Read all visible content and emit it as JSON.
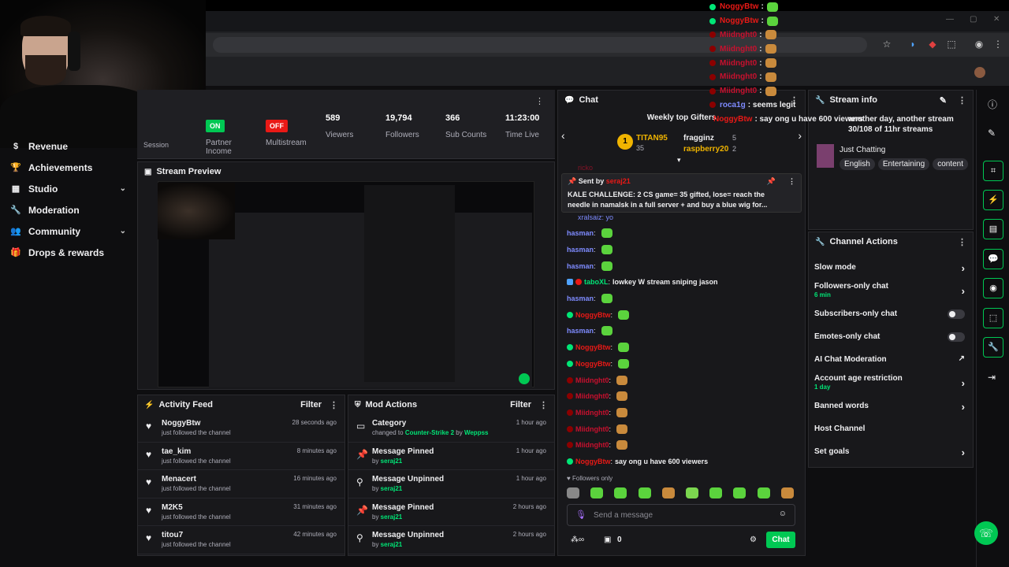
{
  "sidebar": {
    "items": [
      {
        "label": "Revenue",
        "icon": "dollar-icon",
        "expandable": false
      },
      {
        "label": "Achievements",
        "icon": "trophy-icon",
        "expandable": false
      },
      {
        "label": "Studio",
        "icon": "studio-icon",
        "expandable": true
      },
      {
        "label": "Moderation",
        "icon": "wrench-icon",
        "expandable": false
      },
      {
        "label": "Community",
        "icon": "people-icon",
        "expandable": true
      },
      {
        "label": "Drops & rewards",
        "icon": "gift-icon",
        "expandable": false
      }
    ]
  },
  "stats": {
    "partner_income": {
      "badge": "ON",
      "label": "Partner Income"
    },
    "multistream": {
      "badge": "OFF",
      "label": "Multistream"
    },
    "viewers": {
      "value": "589",
      "label": "Viewers"
    },
    "followers": {
      "value": "19,794",
      "label": "Followers"
    },
    "subs": {
      "value": "366",
      "label": "Sub Counts"
    },
    "time": {
      "value": "11:23:00",
      "label": "Time Live"
    },
    "session_label": "Session"
  },
  "preview": {
    "title": "Stream Preview"
  },
  "activity": {
    "title": "Activity Feed",
    "filter": "Filter",
    "items": [
      {
        "name": "NoggyBtw",
        "sub": "just followed the channel",
        "time": "28 seconds ago"
      },
      {
        "name": "tae_kim",
        "sub": "just followed the channel",
        "time": "8 minutes ago"
      },
      {
        "name": "Menacert",
        "sub": "just followed the channel",
        "time": "16 minutes ago"
      },
      {
        "name": "M2K5",
        "sub": "just followed the channel",
        "time": "31 minutes ago"
      },
      {
        "name": "titou7",
        "sub": "just followed the channel",
        "time": "42 minutes ago"
      }
    ]
  },
  "mod_actions": {
    "title": "Mod Actions",
    "filter": "Filter",
    "items": [
      {
        "name": "Category",
        "pre": "changed to ",
        "target": "Counter-Strike 2",
        "mid": " by ",
        "by": "Weppss",
        "time": "1 hour ago",
        "icon": "category-icon"
      },
      {
        "name": "Message Pinned",
        "pre": "by ",
        "target": "seraj21",
        "mid": "",
        "by": "",
        "time": "1 hour ago",
        "icon": "pin-icon"
      },
      {
        "name": "Message Unpinned",
        "pre": "by ",
        "target": "seraj21",
        "mid": "",
        "by": "",
        "time": "1 hour ago",
        "icon": "unpin-icon"
      },
      {
        "name": "Message Pinned",
        "pre": "by ",
        "target": "seraj21",
        "mid": "",
        "by": "",
        "time": "2 hours ago",
        "icon": "pin-icon"
      },
      {
        "name": "Message Unpinned",
        "pre": "by ",
        "target": "seraj21",
        "mid": "",
        "by": "",
        "time": "2 hours ago",
        "icon": "unpin-icon"
      }
    ]
  },
  "chat": {
    "title": "Chat",
    "top_gifters_title": "Weekly top Gifters",
    "gifters": [
      {
        "rank": "1",
        "name": "TITAN95",
        "count": "35"
      },
      {
        "rank": "",
        "name": "fragginz",
        "count": "5"
      },
      {
        "rank": "",
        "name": "raspberry20",
        "count": "2"
      }
    ],
    "pinned": {
      "sent_by_label": "Sent by",
      "sender": "seraj21",
      "text": "KALE CHALLENGE: 2 CS game= 35 gifted, lose= reach the needle in namalsk in a full server + and buy a blue wig for..."
    },
    "partial_top": "ricko",
    "partial_second": "xralsaiz: yo",
    "messages": [
      {
        "nick": "hasman",
        "cls": "nick-h",
        "text": "",
        "emote": true,
        "badge": ""
      },
      {
        "nick": "hasman",
        "cls": "nick-h",
        "text": "",
        "emote": true,
        "badge": ""
      },
      {
        "nick": "hasman",
        "cls": "nick-h",
        "text": "",
        "emote": true,
        "badge": ""
      },
      {
        "nick": "taboXL",
        "cls": "nick-t",
        "text": "lowkey W stream sniping jason",
        "emote": false,
        "badge": "sub"
      },
      {
        "nick": "hasman",
        "cls": "nick-h",
        "text": "",
        "emote": true,
        "badge": ""
      },
      {
        "nick": "NoggyBtw",
        "cls": "nick-n",
        "text": "",
        "emote": true,
        "badge": "green"
      },
      {
        "nick": "hasman",
        "cls": "nick-h",
        "text": "",
        "emote": true,
        "badge": ""
      },
      {
        "nick": "NoggyBtw",
        "cls": "nick-n",
        "text": "",
        "emote": true,
        "badge": "green"
      },
      {
        "nick": "NoggyBtw",
        "cls": "nick-n",
        "text": "",
        "emote": true,
        "badge": "green"
      },
      {
        "nick": "Miidnght0",
        "cls": "nick-m",
        "text": "",
        "emote": true,
        "badge": "red"
      },
      {
        "nick": "Miidnght0",
        "cls": "nick-m",
        "text": "",
        "emote": true,
        "badge": "red"
      },
      {
        "nick": "Miidnght0",
        "cls": "nick-m",
        "text": "",
        "emote": true,
        "badge": "red"
      },
      {
        "nick": "Miidnght0",
        "cls": "nick-m",
        "text": "",
        "emote": true,
        "badge": "red"
      },
      {
        "nick": "Miidnght0",
        "cls": "nick-m",
        "text": "",
        "emote": true,
        "badge": "red"
      },
      {
        "nick": "NoggyBtw",
        "cls": "nick-n",
        "text": "say ong u have 600 viewers",
        "emote": false,
        "badge": "green"
      }
    ],
    "followers_only": "Followers only",
    "input_placeholder": "Send a message",
    "send_label": "Chat",
    "points": "0"
  },
  "stream_info": {
    "title": "Stream info",
    "stream_title": "another day, another stream 30/108 of 11hr streams",
    "category": "Just Chatting",
    "tags": [
      "English",
      "Entertaining",
      "content"
    ]
  },
  "channel_actions": {
    "title": "Channel Actions",
    "items": [
      {
        "label": "Slow mode",
        "sub": "",
        "control": "chevron"
      },
      {
        "label": "Followers-only chat",
        "sub": "6 min",
        "control": "chevron"
      },
      {
        "label": "Subscribers-only chat",
        "sub": "",
        "control": "toggle"
      },
      {
        "label": "Emotes-only chat",
        "sub": "",
        "control": "toggle"
      },
      {
        "label": "AI Chat Moderation",
        "sub": "",
        "control": "chart"
      },
      {
        "label": "Account age restriction",
        "sub": "1 day",
        "control": "chevron"
      },
      {
        "label": "Banned words",
        "sub": "",
        "control": "chevron"
      },
      {
        "label": "Host Channel",
        "sub": "",
        "control": "none"
      },
      {
        "label": "Set goals",
        "sub": "",
        "control": "chevron"
      }
    ]
  },
  "overlay_chat": [
    {
      "nick": "NoggyBtw",
      "text": ":",
      "cls": "nick-n"
    },
    {
      "nick": "NoggyBtw",
      "text": ":",
      "cls": "nick-n"
    },
    {
      "nick": "Miidnght0",
      "text": ":",
      "cls": "nick-m"
    },
    {
      "nick": "Miidnght0",
      "text": ":",
      "cls": "nick-m"
    },
    {
      "nick": "Miidnght0",
      "text": ":",
      "cls": "nick-m"
    },
    {
      "nick": "Miidnght0",
      "text": ":",
      "cls": "nick-m"
    },
    {
      "nick": "Miidnght0",
      "text": ":",
      "cls": "nick-m"
    },
    {
      "nick": "roca1g",
      "text": ": seems legit",
      "cls": "nick-h"
    },
    {
      "nick": "NoggyBtw",
      "text": ": say ong u have 600 viewers",
      "cls": "nick-n"
    }
  ],
  "colors": {
    "accent": "#00c853",
    "bg": "#0e0e10",
    "panel": "#18181b"
  }
}
